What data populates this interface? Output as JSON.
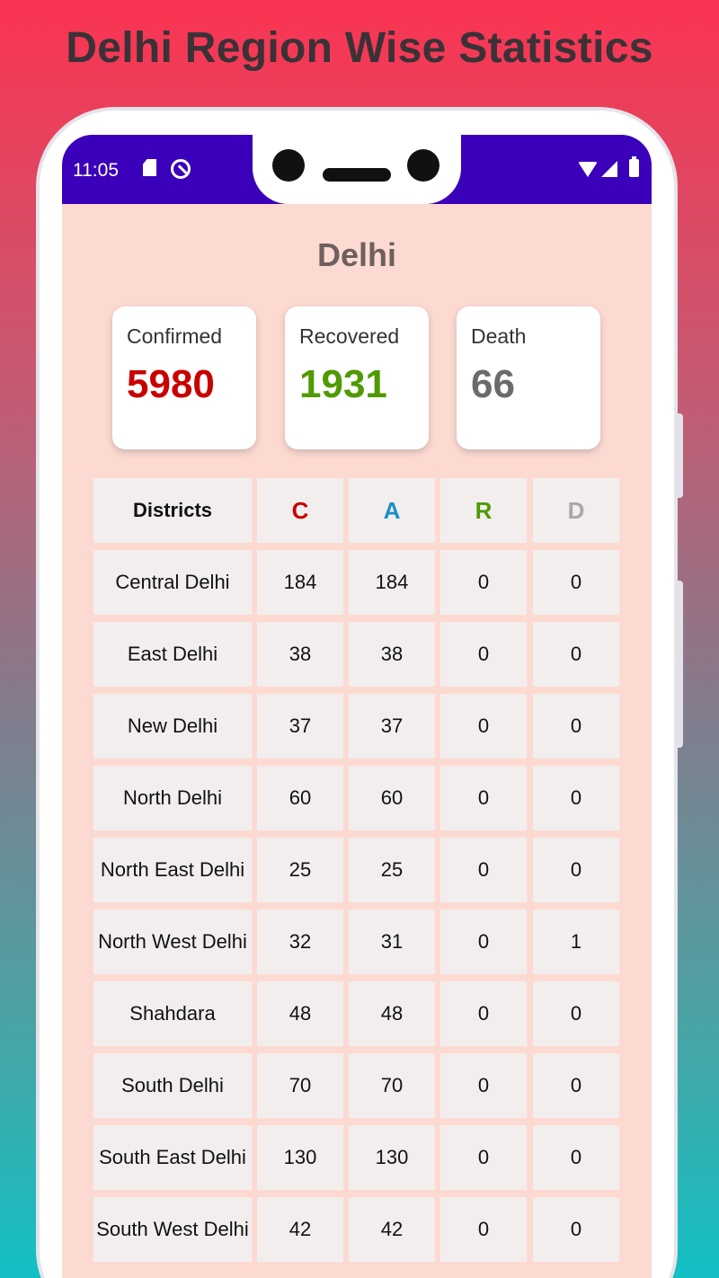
{
  "promo_title": "Delhi Region Wise Statistics",
  "status_bar": {
    "time": "11:05",
    "icons": [
      "sd-card-icon",
      "data-saver-icon",
      "wifi-icon",
      "signal-icon",
      "battery-icon"
    ]
  },
  "region": "Delhi",
  "summary": {
    "confirmed": {
      "label": "Confirmed",
      "value": "5980",
      "color": "#c80000"
    },
    "recovered": {
      "label": "Recovered",
      "value": "1931",
      "color": "#4f9a00"
    },
    "death": {
      "label": "Death",
      "value": "66",
      "color": "#6b6b6b"
    }
  },
  "table": {
    "headers": [
      "Districts",
      "C",
      "A",
      "R",
      "D"
    ],
    "rows": [
      [
        "Central Delhi",
        "184",
        "184",
        "0",
        "0"
      ],
      [
        "East Delhi",
        "38",
        "38",
        "0",
        "0"
      ],
      [
        "New Delhi",
        "37",
        "37",
        "0",
        "0"
      ],
      [
        "North Delhi",
        "60",
        "60",
        "0",
        "0"
      ],
      [
        "North East Delhi",
        "25",
        "25",
        "0",
        "0"
      ],
      [
        "North West Delhi",
        "32",
        "31",
        "0",
        "1"
      ],
      [
        "Shahdara",
        "48",
        "48",
        "0",
        "0"
      ],
      [
        "South Delhi",
        "70",
        "70",
        "0",
        "0"
      ],
      [
        "South East Delhi",
        "130",
        "130",
        "0",
        "0"
      ],
      [
        "South West Delhi",
        "42",
        "42",
        "0",
        "0"
      ]
    ]
  },
  "colors": {
    "statusbar": "#3b00b9",
    "screen_bg": "#fcdad2",
    "cell_bg": "#f3eeee"
  }
}
